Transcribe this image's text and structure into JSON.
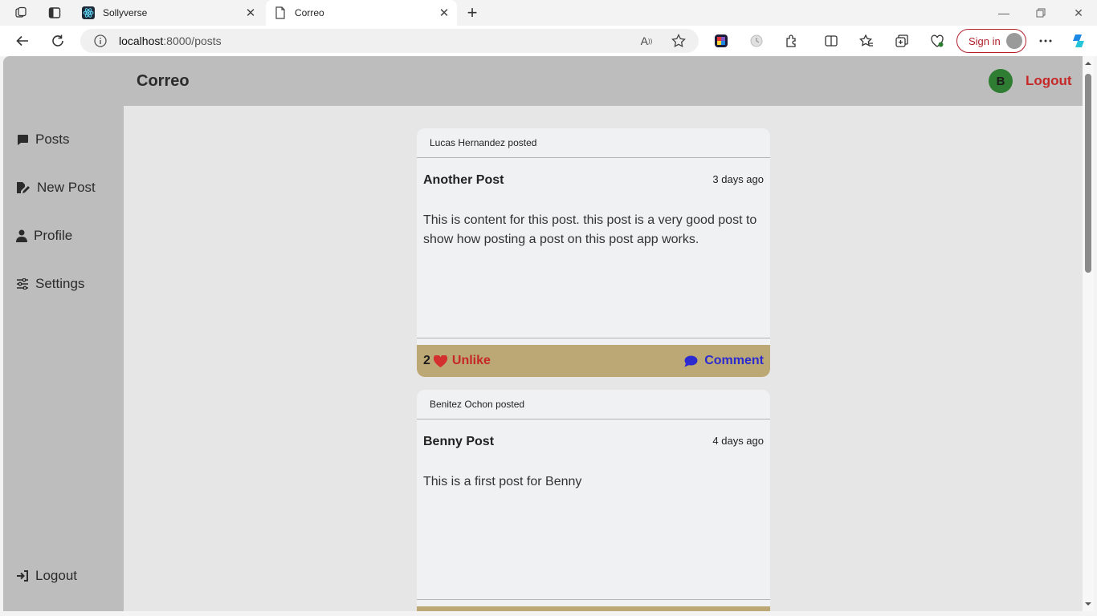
{
  "browser": {
    "tabs": [
      {
        "title": "Sollyverse",
        "active": false
      },
      {
        "title": "Correo",
        "active": true
      }
    ],
    "url_host": "localhost",
    "url_rest": ":8000/posts",
    "signin_label": "Sign in"
  },
  "app": {
    "brand": "Correo",
    "user_initial": "B",
    "logout_label": "Logout"
  },
  "sidebar": {
    "items": [
      {
        "label": "Posts",
        "icon": "comment-icon"
      },
      {
        "label": "New Post",
        "icon": "file-edit-icon"
      },
      {
        "label": "Profile",
        "icon": "user-icon"
      },
      {
        "label": "Settings",
        "icon": "sliders-icon"
      }
    ],
    "logout_label": "Logout"
  },
  "posts": [
    {
      "author": "Lucas Hernandez",
      "posted_suffix": "posted",
      "title": "Another Post",
      "time": "3 days ago",
      "content": "This is content for this post. this post is a very good post to show how posting a post on this post app works.",
      "like_count": "2",
      "like_label": "Unlike",
      "comment_label": "Comment"
    },
    {
      "author": "Benitez Ochon",
      "posted_suffix": "posted",
      "title": "Benny Post",
      "time": "4 days ago",
      "content": "This is a first post for Benny"
    }
  ],
  "colors": {
    "chrome_bg": "#bdbdbd",
    "page_bg": "#e6e6e6",
    "card_bg": "#f0f1f3",
    "action_bar": "#bba874",
    "danger": "#c62828",
    "link": "#2b2bd0",
    "avatar": "#2e7d32"
  }
}
